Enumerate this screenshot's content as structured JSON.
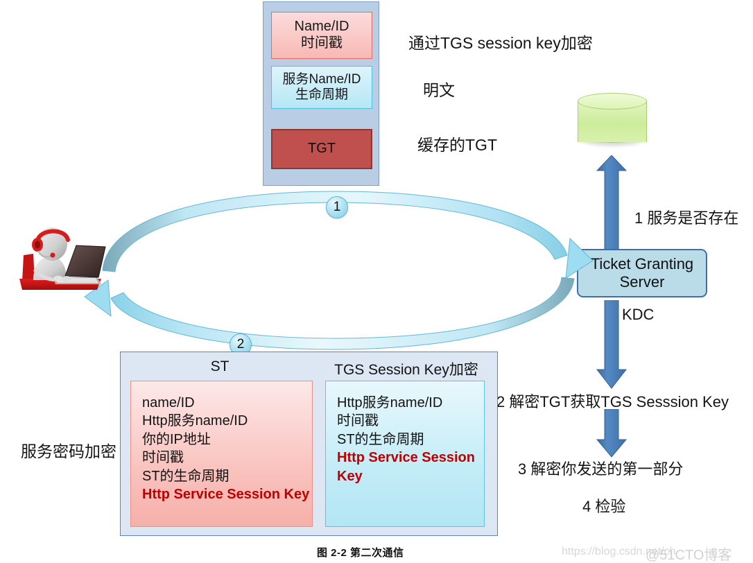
{
  "figure": {
    "caption": "图 2-2 第二次通信"
  },
  "top_packet": {
    "auth_block": {
      "line1": "Name/ID",
      "line2": "时间戳"
    },
    "service_block": {
      "line1": "服务Name/ID",
      "line2": "生命周期"
    },
    "tgt_block": {
      "label": "TGT"
    }
  },
  "top_notes": {
    "encrypted_with": "通过TGS session key加密",
    "plaintext": "明文",
    "cached_tgt": "缓存的TGT"
  },
  "server": {
    "database_icon": "database-cylinder",
    "tgs_line1": "Ticket Granting",
    "tgs_line2": "Server",
    "kdc_label": "KDC"
  },
  "server_steps": {
    "step1": "1 服务是否存在",
    "step2": "2 解密TGT获取TGS Sesssion Key",
    "step3": "3 解密你发送的第一部分",
    "step4": "4 检验"
  },
  "flow": {
    "badge_request": "1",
    "badge_response": "2",
    "client_icon": "client-user-laptop"
  },
  "left_note": {
    "service_password_encrypted": "服务密码加密"
  },
  "bottom_panel": {
    "st_title": "ST",
    "tgs_title": "TGS Session Key加密",
    "st_lines": [
      {
        "text": "name/ID",
        "highlight": false
      },
      {
        "text": "Http服务name/ID",
        "highlight": false
      },
      {
        "text": "你的IP地址",
        "highlight": false
      },
      {
        "text": "时间戳",
        "highlight": false
      },
      {
        "text": "ST的生命周期",
        "highlight": false
      },
      {
        "text": "Http Service Session Key",
        "highlight": true
      }
    ],
    "tgs_lines": [
      {
        "text": "Http服务name/ID",
        "highlight": false
      },
      {
        "text": "时间戳",
        "highlight": false
      },
      {
        "text": "ST的生命周期",
        "highlight": false
      },
      {
        "text": "Http Service Session",
        "highlight": true
      },
      {
        "text": "Key",
        "highlight": true
      }
    ]
  },
  "watermarks": {
    "url": "https://blog.csdn.net/ch",
    "site": "@51CTO博客"
  },
  "colors": {
    "panel_blue": "#b9cde5",
    "panel_blue_light": "#dde7f4",
    "pink": "#f8b9b4",
    "cyan": "#b5e7f5",
    "tgt_red": "#c0504d",
    "highlight_red": "#c00000",
    "arrow_blue": "#4a7ebb",
    "flow_cyan": "#9fdcf0",
    "server_box": "#b9dce8",
    "server_border": "#3f6fa8",
    "db_green": "#cdec9b"
  }
}
